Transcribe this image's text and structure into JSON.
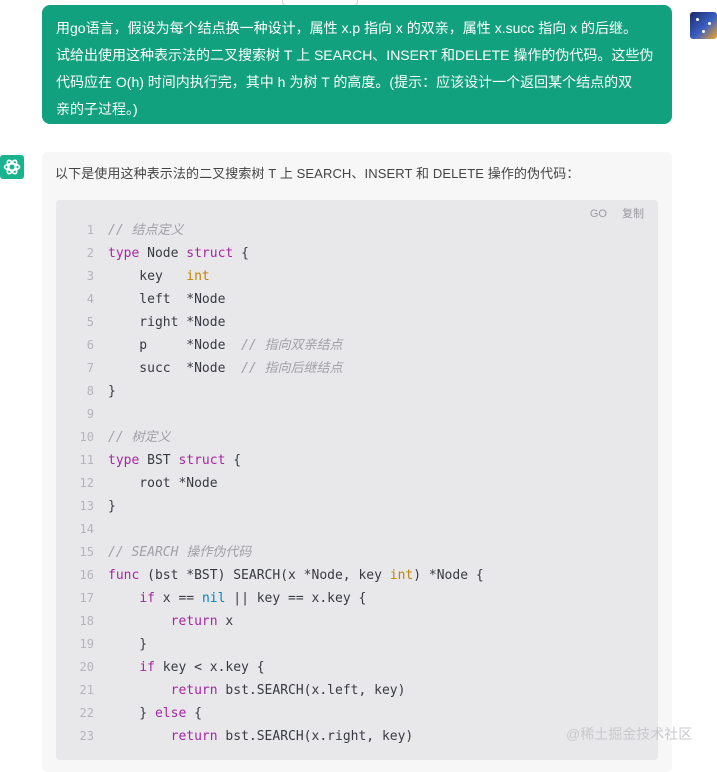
{
  "user_message": {
    "line1": "用go语言，假设为每个结点换一种设计，属性 x.p 指向 x 的双亲，属性 x.succ 指向 x 的后继。",
    "line2": "试给出使用这种表示法的二叉搜索树 T 上 SEARCH、INSERT 和DELETE 操作的伪代码。这些伪",
    "line3": "代码应在 O(h) 时间内执行完，其中 h 为树 T 的高度。(提示：应该设计一个返回某个结点的双",
    "line4": "亲的子过程。)"
  },
  "answer": {
    "intro": "以下是使用这种表示法的二叉搜索树 T 上 SEARCH、INSERT 和 DELETE 操作的伪代码："
  },
  "code_block": {
    "language_label": "GO",
    "copy_label": "复制",
    "lines": [
      {
        "n": "1",
        "tokens": [
          {
            "t": "// 结点定义",
            "c": "cm"
          }
        ]
      },
      {
        "n": "2",
        "tokens": [
          {
            "t": "type",
            "c": "kw"
          },
          {
            "t": " Node ",
            "c": "pl"
          },
          {
            "t": "struct",
            "c": "kw"
          },
          {
            "t": " {",
            "c": "pl"
          }
        ]
      },
      {
        "n": "3",
        "tokens": [
          {
            "t": "    key   ",
            "c": "pl"
          },
          {
            "t": "int",
            "c": "type"
          }
        ]
      },
      {
        "n": "4",
        "tokens": [
          {
            "t": "    left  *Node",
            "c": "pl"
          }
        ]
      },
      {
        "n": "5",
        "tokens": [
          {
            "t": "    right *Node",
            "c": "pl"
          }
        ]
      },
      {
        "n": "6",
        "tokens": [
          {
            "t": "    p     *Node  ",
            "c": "pl"
          },
          {
            "t": "// 指向双亲结点",
            "c": "cm"
          }
        ]
      },
      {
        "n": "7",
        "tokens": [
          {
            "t": "    succ  *Node  ",
            "c": "pl"
          },
          {
            "t": "// 指向后继结点",
            "c": "cm"
          }
        ]
      },
      {
        "n": "8",
        "tokens": [
          {
            "t": "}",
            "c": "pl"
          }
        ]
      },
      {
        "n": "9",
        "tokens": []
      },
      {
        "n": "10",
        "tokens": [
          {
            "t": "// 树定义",
            "c": "cm"
          }
        ]
      },
      {
        "n": "11",
        "tokens": [
          {
            "t": "type",
            "c": "kw"
          },
          {
            "t": " BST ",
            "c": "pl"
          },
          {
            "t": "struct",
            "c": "kw"
          },
          {
            "t": " {",
            "c": "pl"
          }
        ]
      },
      {
        "n": "12",
        "tokens": [
          {
            "t": "    root *Node",
            "c": "pl"
          }
        ]
      },
      {
        "n": "13",
        "tokens": [
          {
            "t": "}",
            "c": "pl"
          }
        ]
      },
      {
        "n": "14",
        "tokens": []
      },
      {
        "n": "15",
        "tokens": [
          {
            "t": "// SEARCH 操作伪代码",
            "c": "cm"
          }
        ]
      },
      {
        "n": "16",
        "tokens": [
          {
            "t": "func",
            "c": "kw"
          },
          {
            "t": " (bst *BST) SEARCH(x *Node, key ",
            "c": "pl"
          },
          {
            "t": "int",
            "c": "type"
          },
          {
            "t": ") *Node {",
            "c": "pl"
          }
        ]
      },
      {
        "n": "17",
        "tokens": [
          {
            "t": "    ",
            "c": "pl"
          },
          {
            "t": "if",
            "c": "kw"
          },
          {
            "t": " x == ",
            "c": "pl"
          },
          {
            "t": "nil",
            "c": "nil"
          },
          {
            "t": " || key == x.key {",
            "c": "pl"
          }
        ]
      },
      {
        "n": "18",
        "tokens": [
          {
            "t": "        ",
            "c": "pl"
          },
          {
            "t": "return",
            "c": "kw"
          },
          {
            "t": " x",
            "c": "pl"
          }
        ]
      },
      {
        "n": "19",
        "tokens": [
          {
            "t": "    }",
            "c": "pl"
          }
        ]
      },
      {
        "n": "20",
        "tokens": [
          {
            "t": "    ",
            "c": "pl"
          },
          {
            "t": "if",
            "c": "kw"
          },
          {
            "t": " key < x.key {",
            "c": "pl"
          }
        ]
      },
      {
        "n": "21",
        "tokens": [
          {
            "t": "        ",
            "c": "pl"
          },
          {
            "t": "return",
            "c": "kw"
          },
          {
            "t": " bst.SEARCH(x.left, key)",
            "c": "pl"
          }
        ]
      },
      {
        "n": "22",
        "tokens": [
          {
            "t": "    } ",
            "c": "pl"
          },
          {
            "t": "else",
            "c": "kw"
          },
          {
            "t": " {",
            "c": "pl"
          }
        ]
      },
      {
        "n": "23",
        "tokens": [
          {
            "t": "        ",
            "c": "pl"
          },
          {
            "t": "return",
            "c": "kw"
          },
          {
            "t": " bst.SEARCH(x.right, key)",
            "c": "pl"
          }
        ]
      }
    ]
  },
  "watermark": "@稀土掘金技术社区",
  "colors": {
    "user_bubble": "#12a17e",
    "bot_avatar": "#19b38d",
    "code_bg": "#e8e8eb",
    "keyword": "#a626a4",
    "type": "#c18401",
    "comment": "#a0a1a7"
  }
}
